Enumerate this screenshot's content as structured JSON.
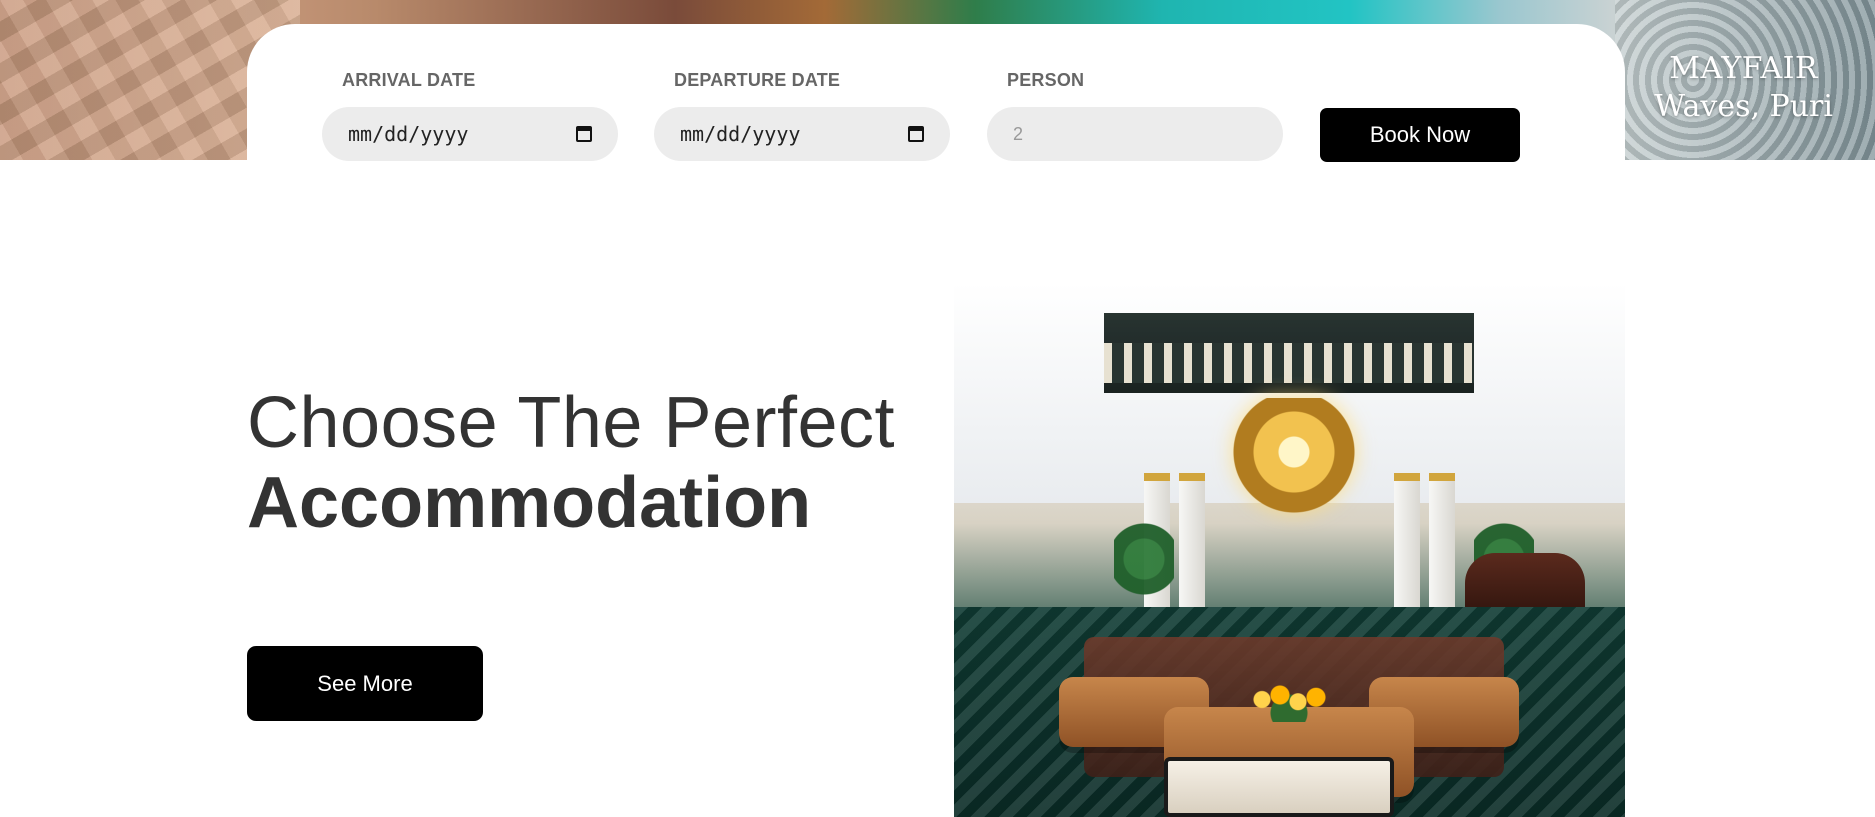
{
  "brand": {
    "line1": "MAYFAIR",
    "line2": "Waves, Puri"
  },
  "booking": {
    "arrival": {
      "label": "ARRIVAL DATE",
      "value": "mm/dd/yyyy",
      "icon": "calendar-icon"
    },
    "departure": {
      "label": "DEPARTURE DATE",
      "value": "mm/dd/yyyy",
      "icon": "calendar-icon"
    },
    "person": {
      "label": "PERSON",
      "placeholder": "2"
    },
    "book_button": "Book Now"
  },
  "section": {
    "heading_light": "Choose The Perfect",
    "heading_bold": "Accommodation",
    "cta": "See More"
  },
  "colors": {
    "primary_button": "#000000",
    "input_bg": "#ececec",
    "text_dark": "#333333",
    "label_gray": "#666666"
  }
}
